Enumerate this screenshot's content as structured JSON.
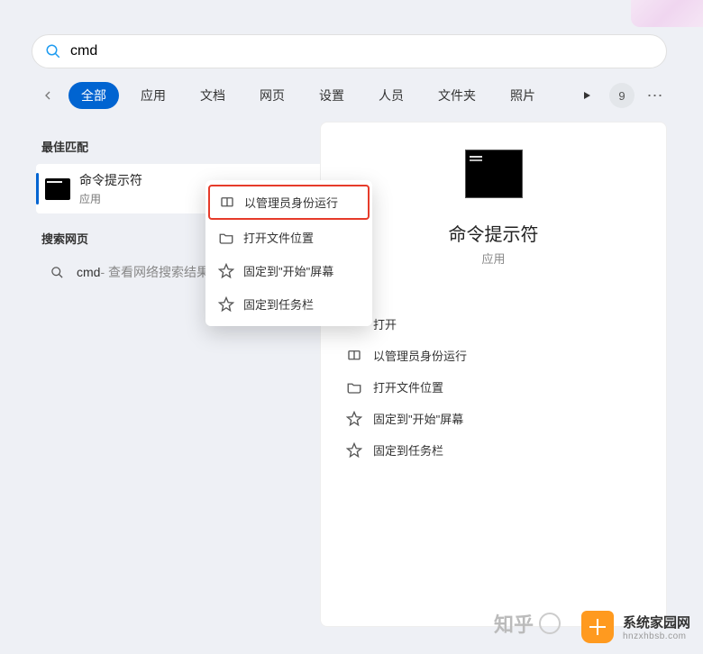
{
  "search": {
    "query": "cmd"
  },
  "filters": {
    "items": [
      "全部",
      "应用",
      "文档",
      "网页",
      "设置",
      "人员",
      "文件夹",
      "照片"
    ],
    "active": 0,
    "badge": "9"
  },
  "sections": {
    "best_match_header": "最佳匹配",
    "search_web_header": "搜索网页"
  },
  "best_match": {
    "title": "命令提示符",
    "subtitle": "应用"
  },
  "web_result": {
    "term": "cmd",
    "suffix": " - 查看网络搜索结果"
  },
  "context_menu": {
    "items": [
      {
        "icon": "shield-icon",
        "label": "以管理员身份运行",
        "highlight": true
      },
      {
        "icon": "folder-icon",
        "label": "打开文件位置"
      },
      {
        "icon": "pin-icon",
        "label": "固定到\"开始\"屏幕"
      },
      {
        "icon": "pin-icon",
        "label": "固定到任务栏"
      }
    ]
  },
  "preview": {
    "title": "命令提示符",
    "subtitle": "应用",
    "actions": [
      {
        "icon": "open-icon",
        "label": "打开"
      },
      {
        "icon": "shield-icon",
        "label": "以管理员身份运行"
      },
      {
        "icon": "folder-icon",
        "label": "打开文件位置"
      },
      {
        "icon": "pin-icon",
        "label": "固定到\"开始\"屏幕"
      },
      {
        "icon": "pin-icon",
        "label": "固定到任务栏"
      }
    ]
  },
  "watermarks": {
    "zhihu": "知乎",
    "brand_line1": "系统家园网",
    "brand_line2": "hnzxhbsb.com"
  },
  "icons": {
    "search_color": "#2196f3"
  }
}
